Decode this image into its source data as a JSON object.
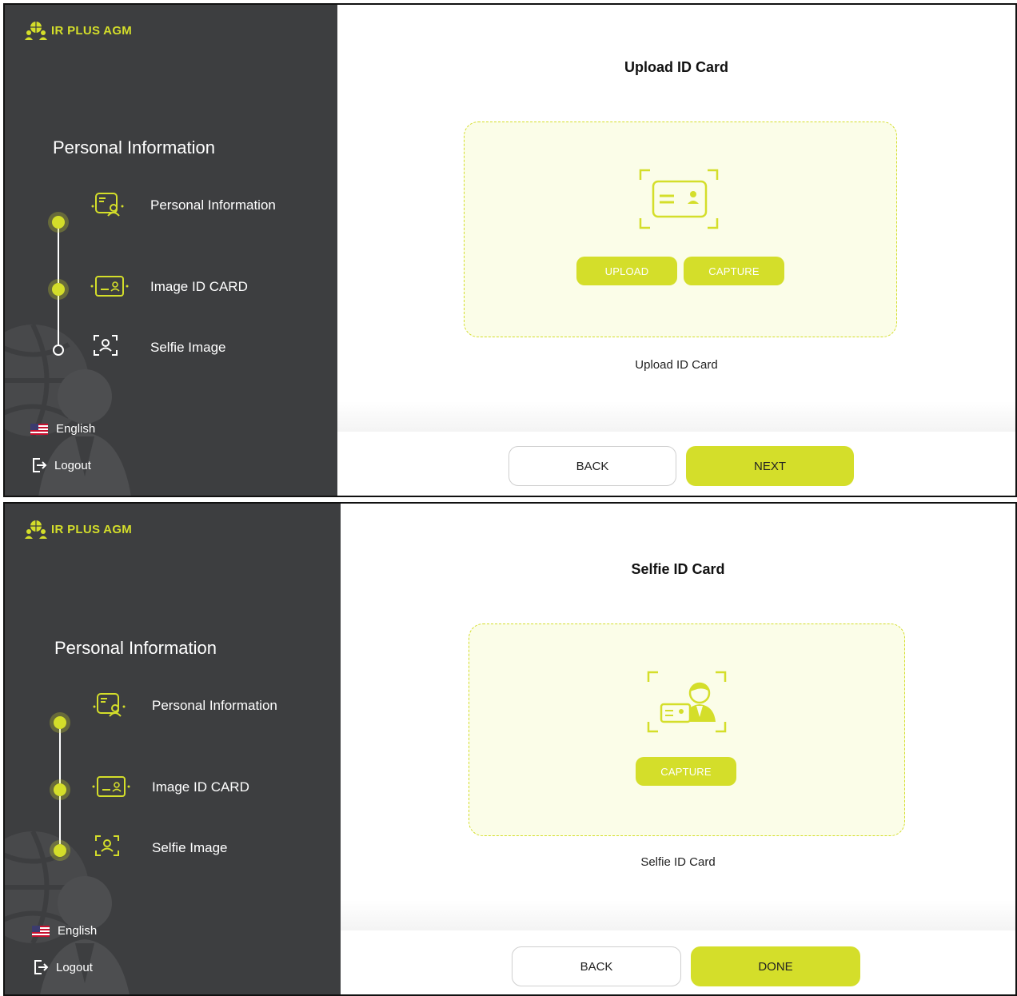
{
  "colors": {
    "accent": "#d4de2a",
    "sidebar": "#3d3e40",
    "box_bg": "#fbfde8"
  },
  "brand": {
    "name": "IR PLUS AGM",
    "icon": "people-globe-logo-icon"
  },
  "screens": [
    {
      "sidebar": {
        "title": "Personal Information",
        "steps": [
          {
            "label": "Personal Information",
            "icon": "user-card-icon",
            "state": "done"
          },
          {
            "label": "Image ID CARD",
            "icon": "id-card-icon",
            "state": "done"
          },
          {
            "label": "Selfie Image",
            "icon": "face-scan-icon",
            "state": "pending"
          }
        ],
        "language": "English",
        "logout": "Logout"
      },
      "main": {
        "title": "Upload ID Card",
        "illustration": "id-card-frame-icon",
        "actions": [
          "UPLOAD",
          "CAPTURE"
        ],
        "caption": "Upload ID Card",
        "back_label": "BACK",
        "primary_label": "NEXT"
      }
    },
    {
      "sidebar": {
        "title": "Personal Information",
        "steps": [
          {
            "label": "Personal Information",
            "icon": "user-card-icon",
            "state": "done"
          },
          {
            "label": "Image ID CARD",
            "icon": "id-card-icon",
            "state": "done"
          },
          {
            "label": "Selfie Image",
            "icon": "face-scan-icon",
            "state": "done"
          }
        ],
        "language": "English",
        "logout": "Logout"
      },
      "main": {
        "title": "Selfie ID Card",
        "illustration": "selfie-with-id-icon",
        "actions": [
          "CAPTURE"
        ],
        "caption": "Selfie ID Card",
        "back_label": "BACK",
        "primary_label": "DONE"
      }
    }
  ]
}
